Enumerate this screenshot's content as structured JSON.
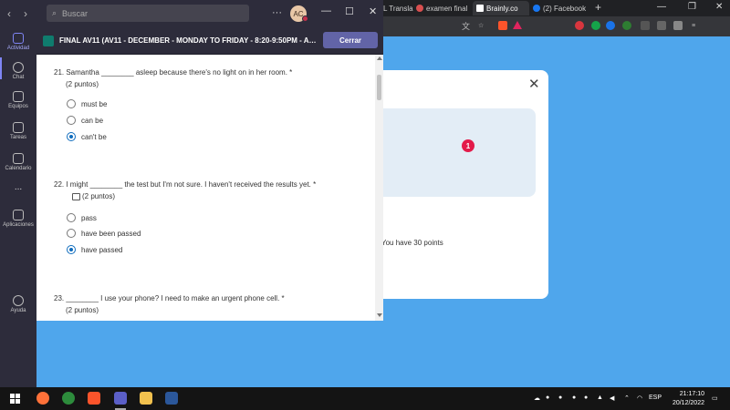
{
  "browser": {
    "tabs": [
      {
        "label": "L Transla",
        "color": "#4a90d9"
      },
      {
        "label": "examen final",
        "color": "#d94f4f"
      },
      {
        "label": "Brainly.co",
        "color": "#ffffff"
      },
      {
        "label": "(2) Facebook",
        "color": "#1877f2"
      }
    ],
    "new_tab": "+"
  },
  "modal": {
    "close": "✕",
    "badge": "1",
    "points_text": "You have 30 points"
  },
  "teams": {
    "search_placeholder": "Buscar",
    "avatar_initials": "AC",
    "rail": [
      {
        "label": "Actividad"
      },
      {
        "label": "Chat"
      },
      {
        "label": "Equipos"
      },
      {
        "label": "Tareas"
      },
      {
        "label": "Calendario"
      },
      {
        "label": "..."
      },
      {
        "label": "Aplicaciones"
      },
      {
        "label": "Ayuda"
      }
    ]
  },
  "form": {
    "title": "FINAL AV11 (AV11 - DECEMBER - MONDAY TO FRIDAY - 8:20-9:50PM - ARM...",
    "close_label": "Cerrar",
    "questions": [
      {
        "text": "21. Samantha ________ asleep because there's no light on in her room. *",
        "points": "(2 puntos)",
        "options": [
          "must be",
          "can be",
          "can't be"
        ],
        "selected": 2
      },
      {
        "text": "22. I might ________ the test but I'm not sure. I haven't received the results yet. *",
        "points": "(2 puntos)",
        "options": [
          "pass",
          "have been passed",
          "have passed"
        ],
        "selected": 2
      },
      {
        "text": "23. ________ I use your phone? I need to make an urgent phone cell. *",
        "points": "(2 puntos)",
        "options": [],
        "selected": null
      }
    ]
  },
  "taskbar": {
    "time": "21:17:10",
    "date": "20/12/2022",
    "lang": "ESP"
  }
}
